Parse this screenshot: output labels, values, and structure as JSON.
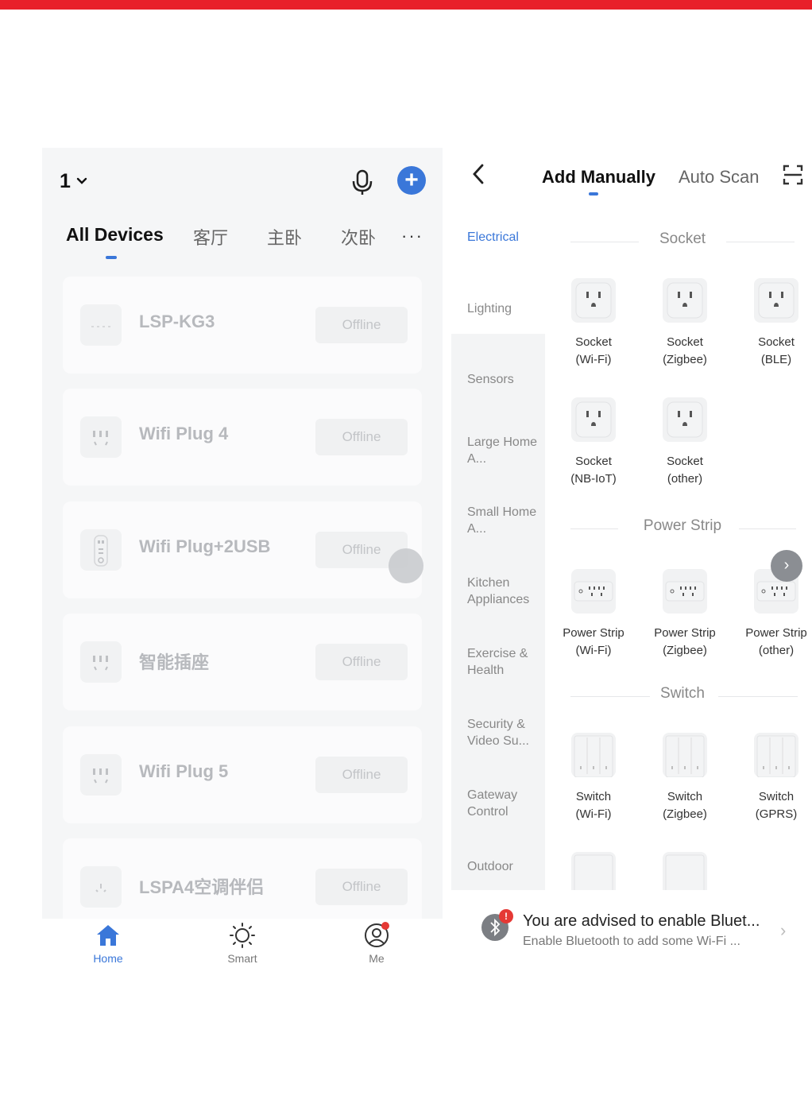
{
  "left": {
    "home_name": "1",
    "room_tabs": [
      "All Devices",
      "客厅",
      "主卧",
      "次卧"
    ],
    "more_label": "···",
    "devices": [
      {
        "name": "LSP-KG3",
        "status": "Offline",
        "icon": "plug-icon"
      },
      {
        "name": "Wifi Plug 4",
        "status": "Offline",
        "icon": "socket-icon"
      },
      {
        "name": "Wifi Plug+2USB",
        "status": "Offline",
        "icon": "usb-plug-icon"
      },
      {
        "name": "智能插座",
        "status": "Offline",
        "icon": "socket-icon"
      },
      {
        "name": "Wifi Plug 5",
        "status": "Offline",
        "icon": "socket-icon"
      },
      {
        "name": "LSPA4空调伴侣",
        "status": "Offline",
        "icon": "ac-companion-icon"
      }
    ],
    "nav": {
      "home": "Home",
      "smart": "Smart",
      "me": "Me"
    },
    "accent": "#3a77d9"
  },
  "right": {
    "tabs": {
      "manual": "Add Manually",
      "auto": "Auto Scan"
    },
    "categories": [
      "Electrical",
      "Lighting",
      "Sensors",
      "Large Home A...",
      "Small Home A...",
      "Kitchen Appliances",
      "Exercise & Health",
      "Security & Video Su...",
      "Gateway Control",
      "Outdoor"
    ],
    "sections": {
      "socket": {
        "title": "Socket",
        "items": [
          {
            "l1": "Socket",
            "l2": "(Wi-Fi)"
          },
          {
            "l1": "Socket",
            "l2": "(Zigbee)"
          },
          {
            "l1": "Socket",
            "l2": "(BLE)"
          },
          {
            "l1": "Socket",
            "l2": "(NB-IoT)"
          },
          {
            "l1": "Socket",
            "l2": "(other)"
          }
        ]
      },
      "power_strip": {
        "title": "Power Strip",
        "items": [
          {
            "l1": "Power Strip",
            "l2": "(Wi-Fi)"
          },
          {
            "l1": "Power Strip",
            "l2": "(Zigbee)"
          },
          {
            "l1": "Power Strip",
            "l2": "(other)"
          }
        ]
      },
      "switch": {
        "title": "Switch",
        "items": [
          {
            "l1": "Switch",
            "l2": "(Wi-Fi)"
          },
          {
            "l1": "Switch",
            "l2": "(Zigbee)"
          },
          {
            "l1": "Switch",
            "l2": "(GPRS)"
          }
        ]
      }
    },
    "banner": {
      "title": "You are advised to enable Bluet...",
      "subtitle": "Enable Bluetooth to add some Wi-Fi ...",
      "badge": "!"
    }
  }
}
